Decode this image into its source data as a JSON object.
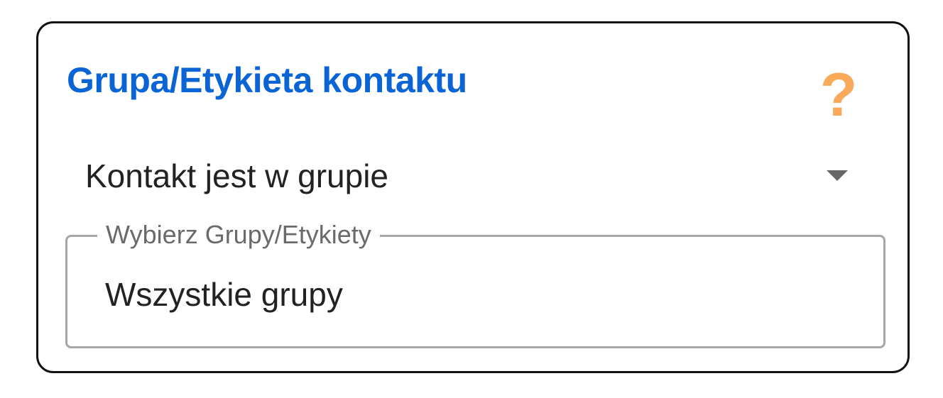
{
  "panel": {
    "title": "Grupa/Etykieta kontaktu",
    "help_icon": "?",
    "help_color": "#f8a95a",
    "title_color": "#0a64d6"
  },
  "condition_select": {
    "value": "Kontakt jest w grupie",
    "icon": "caret-down-icon"
  },
  "groups_field": {
    "label": "Wybierz Grupy/Etykiety",
    "value": "Wszystkie grupy"
  }
}
